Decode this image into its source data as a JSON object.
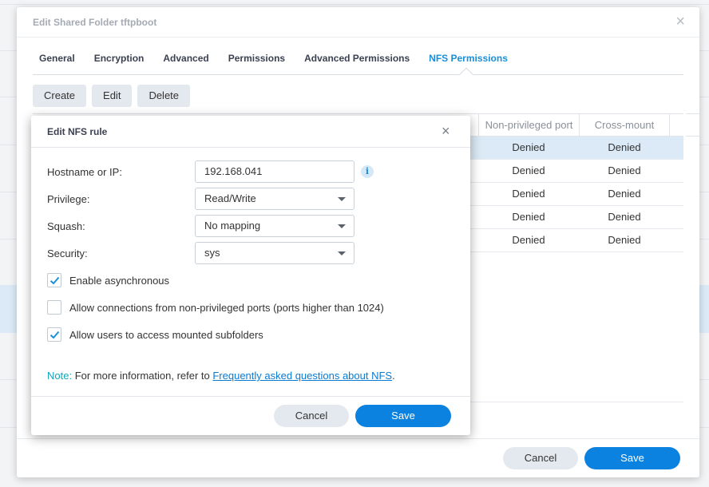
{
  "window": {
    "title": "Edit Shared Folder tftpboot",
    "close_glyph": "×"
  },
  "tabs": [
    {
      "label": "General",
      "active": false
    },
    {
      "label": "Encryption",
      "active": false
    },
    {
      "label": "Advanced",
      "active": false
    },
    {
      "label": "Permissions",
      "active": false
    },
    {
      "label": "Advanced Permissions",
      "active": false
    },
    {
      "label": "NFS Permissions",
      "active": true
    }
  ],
  "toolbar": {
    "create_label": "Create",
    "edit_label": "Edit",
    "delete_label": "Delete"
  },
  "grid": {
    "columns": {
      "non_privileged_port": "Non-privileged port",
      "cross_mount": "Cross-mount"
    },
    "rows": [
      {
        "non_privileged_port": "Denied",
        "cross_mount": "Denied",
        "selected": true
      },
      {
        "non_privileged_port": "Denied",
        "cross_mount": "Denied",
        "selected": false
      },
      {
        "non_privileged_port": "Denied",
        "cross_mount": "Denied",
        "selected": false
      },
      {
        "non_privileged_port": "Denied",
        "cross_mount": "Denied",
        "selected": false
      },
      {
        "non_privileged_port": "Denied",
        "cross_mount": "Denied",
        "selected": false
      }
    ]
  },
  "window_footer": {
    "cancel_label": "Cancel",
    "save_label": "Save"
  },
  "dialog": {
    "title": "Edit NFS rule",
    "close_glyph": "×",
    "hostname": {
      "label": "Hostname or IP:",
      "value": "192.168.041",
      "info_glyph": "i"
    },
    "privilege": {
      "label": "Privilege:",
      "value": "Read/Write"
    },
    "squash": {
      "label": "Squash:",
      "value": "No mapping"
    },
    "security": {
      "label": "Security:",
      "value": "sys"
    },
    "checkboxes": [
      {
        "label": "Enable asynchronous",
        "checked": true
      },
      {
        "label": "Allow connections from non-privileged ports (ports higher than 1024)",
        "checked": false
      },
      {
        "label": "Allow users to access mounted subfolders",
        "checked": true
      }
    ],
    "note": {
      "prefix": "Note:",
      "text": " For more information, refer to ",
      "link": "Frequently asked questions about NFS",
      "suffix": "."
    },
    "cancel_label": "Cancel",
    "save_label": "Save"
  },
  "colors": {
    "accent": "#0b82e0",
    "selected_row": "#dbeaf6",
    "note_label": "#12a5b9"
  }
}
